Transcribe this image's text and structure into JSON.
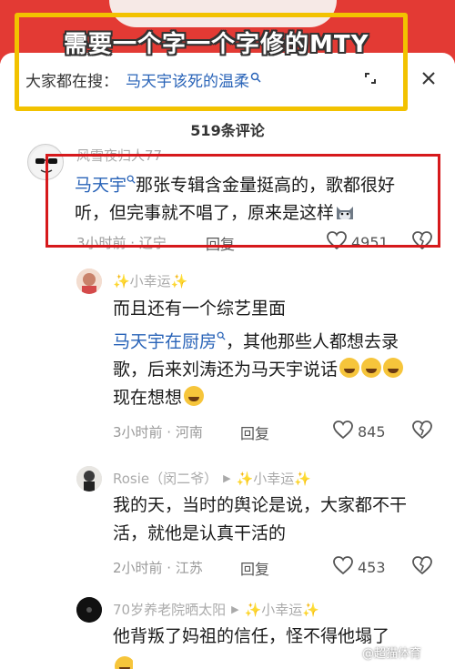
{
  "overlay_title": "需要一个字一个字修的MTY",
  "search": {
    "prefix": "大家都在搜：",
    "query": "马天宇该死的温柔",
    "query_icon": "search-icon"
  },
  "comment_count": "519条评论",
  "comments": [
    {
      "username": "风雪夜归人77",
      "link": "马天宇",
      "text1": "那张专辑含金量挺高的，歌都很好",
      "text2": "听，但完事就不唱了，原来是这样",
      "time": "3小时前 · 辽宁",
      "reply": "回复",
      "likes": "4951"
    },
    {
      "username": "✨小幸运✨",
      "line1": "而且还有一个综艺里面",
      "link": "马天宇在厨房",
      "line2": "，其他那些人都想去录",
      "line3": "歌，后来刘涛还为马天宇说话",
      "line4": "现在想想",
      "time": "3小时前 · 河南",
      "reply": "回复",
      "likes": "845"
    },
    {
      "username": "Rosie（闵二爷）",
      "reply_to": "✨小幸运✨",
      "line1": "我的天，当时的舆论是说，大家都不干",
      "line2": "活，就他是认真干活的",
      "time": "2小时前 · 江苏",
      "reply": "回复",
      "likes": "453"
    },
    {
      "username": "70岁养老院晒太阳",
      "reply_to": "✨小幸运✨",
      "line1": "他背叛了妈祖的信任，怪不得他塌了"
    }
  ],
  "watermark": "@超猫体育",
  "colors": {
    "link": "#2a64b8",
    "annotation_yellow": "#f2c200",
    "annotation_red": "#d6191c"
  }
}
